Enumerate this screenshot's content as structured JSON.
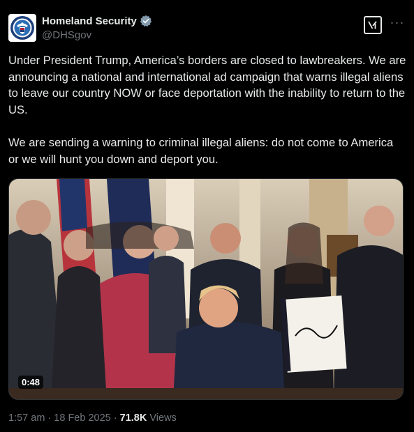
{
  "author": {
    "display_name": "Homeland Security",
    "handle": "@DHSgov",
    "verified": true,
    "avatar_icon": "dhs-seal-icon"
  },
  "actions": {
    "grok_icon": "grok-icon",
    "more_label": "···"
  },
  "tweet": {
    "paragraphs": [
      "Under President Trump, America’s borders are closed to lawbreakers. We are announcing a national and international ad campaign that warns illegal aliens to leave our country NOW or face deportation with the inability to return to the US.",
      "We are sending a warning to criminal  illegal aliens: do not come to America or we will hunt you down and deport you."
    ]
  },
  "media": {
    "type": "video",
    "duration": "0:48",
    "description_icon": "video-thumbnail"
  },
  "meta": {
    "time": "1:57 am",
    "separator": " · ",
    "date": "18 Feb 2025",
    "views_count": "71.8K",
    "views_label": " Views"
  },
  "colors": {
    "background": "#000000",
    "text": "#e7e9ea",
    "secondary": "#71767b",
    "verified": "#829aab"
  }
}
